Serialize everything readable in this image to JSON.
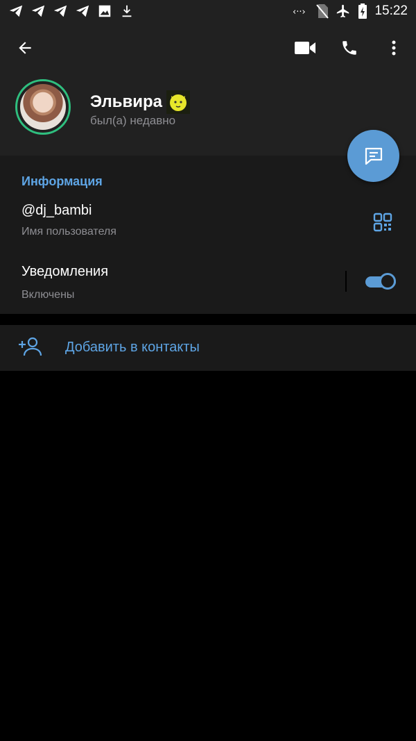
{
  "status_bar": {
    "time": "15:22",
    "left_icons": [
      "telegram-icon",
      "telegram-icon",
      "telegram-icon",
      "telegram-icon",
      "image-icon",
      "download-icon"
    ],
    "right_icons": [
      "data-saver-icon",
      "no-sim-icon",
      "airplane-icon",
      "battery-charging-icon"
    ]
  },
  "app_bar": {
    "back_icon": "arrow-left-icon",
    "video_icon": "video-call-icon",
    "call_icon": "phone-icon",
    "menu_icon": "more-vert-icon"
  },
  "profile": {
    "name": "Эльвира",
    "status": "был(а) недавно",
    "ring_color": "#2fbf7f"
  },
  "fab": {
    "icon": "message-icon",
    "color": "#5b9bd5"
  },
  "info": {
    "section_title": "Информация",
    "username": "@dj_bambi",
    "username_caption": "Имя пользователя",
    "notifications_label": "Уведомления",
    "notifications_caption": "Включены",
    "notifications_on": true
  },
  "add_contact": {
    "label": "Добавить в контакты",
    "icon": "add-person-icon"
  },
  "colors": {
    "accent": "#5ea5e5",
    "panel": "#212121",
    "section": "#1a1a1a"
  }
}
